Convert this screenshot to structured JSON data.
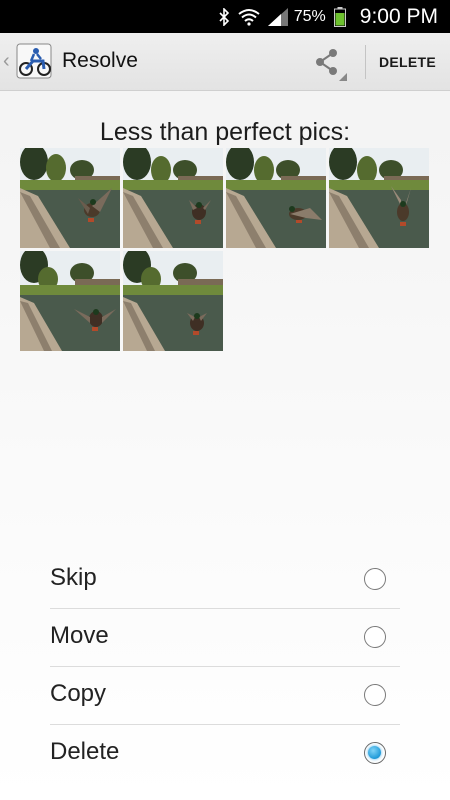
{
  "status_bar": {
    "battery_percent": "75%",
    "time": "9:00 PM",
    "icons": [
      "bluetooth-icon",
      "wifi-icon",
      "signal-icon",
      "battery-icon"
    ]
  },
  "action_bar": {
    "title": "Resolve",
    "share_icon": "share-icon",
    "delete_label": "DELETE"
  },
  "gallery": {
    "heading": "Less than perfect pics:",
    "photos": [
      {
        "name": "duck-photo-1"
      },
      {
        "name": "duck-photo-2"
      },
      {
        "name": "duck-photo-3"
      },
      {
        "name": "duck-photo-4"
      },
      {
        "name": "duck-photo-5"
      },
      {
        "name": "duck-photo-6"
      }
    ]
  },
  "options": [
    {
      "label": "Skip",
      "selected": false
    },
    {
      "label": "Move",
      "selected": false
    },
    {
      "label": "Copy",
      "selected": false
    },
    {
      "label": "Delete",
      "selected": true
    }
  ],
  "colors": {
    "radio_selected": "#1f9ad8",
    "status_bar_bg": "#000000",
    "battery_fill": "#6ec12f"
  }
}
